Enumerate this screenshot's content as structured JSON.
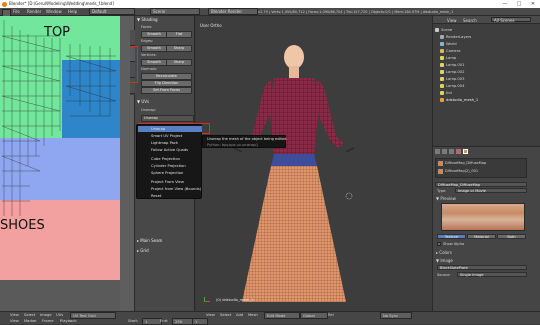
{
  "window": {
    "title": "Blender* [D:\\Gerul\\Modeling\\Wedding\\meds_f.blend]",
    "controls": [
      "—",
      "□",
      "✕"
    ]
  },
  "menubar": {
    "left": [
      "File",
      "Render",
      "Window",
      "Help"
    ],
    "layout": "Default",
    "scene": "Scene",
    "engine": "Blender Render",
    "info": "v2.79 | Verts:1,050/80,712 | Faces:1,090/66,704 | Tris:157,720 | Objects:0/1 | Mem:164.97M | ddstudio_mesh_1"
  },
  "uv_editor": {
    "top_label": "TOP",
    "bottom_label": "SHOES"
  },
  "shelf": {
    "header": "▼ Shading",
    "faces_label": "Faces:",
    "smooth": "Smooth",
    "flat": "Flat",
    "edges_label": "Edges:",
    "edges_smooth": "Smooth",
    "edges_sharp": "Sharp",
    "vertices_label": "Vertices:",
    "vert_smooth": "Smooth",
    "vert_sharp": "Sharp",
    "normals_label": "Normals:",
    "recalculate": "Recalculate",
    "flip_direction": "Flip Direction",
    "set_from_faces": "Set From Faces",
    "uvs_header": "▼ UVs",
    "unwrap_label": "Unwrap:",
    "unwrap_value": "Unwrap",
    "main_seam": "▸ Main Seam",
    "grid": "▸ Grid"
  },
  "popup": {
    "items": [
      "Unwrap",
      "Smart UV Project",
      "Lightmap Pack",
      "Follow Active Quads",
      "Cube Projection",
      "Cylinder Projection",
      "Sphere Projection",
      "Project From View",
      "Project from View (Bounds)",
      "Reset"
    ]
  },
  "tooltip": {
    "line1": "Unwrap the mesh of the object being edited.",
    "line2": "Python: bpy.ops.uv.unwrap()"
  },
  "viewport": {
    "label": "User Ortho",
    "object_label": "(0) ddstudio_mesh_1"
  },
  "outliner": {
    "header_view": "View",
    "header_search": "Search",
    "header_scenes": "All Scenes",
    "rows": [
      {
        "label": "Scene",
        "color": "#c8c8c8"
      },
      {
        "label": "RenderLayers",
        "color": "#a6a6a6"
      },
      {
        "label": "World",
        "color": "#8ab2d8"
      },
      {
        "label": "Camera",
        "color": "#d8b46a"
      },
      {
        "label": "Lamp",
        "color": "#d8d46a"
      },
      {
        "label": "Lamp.001",
        "color": "#d8d46a"
      },
      {
        "label": "Lamp.002",
        "color": "#d8d46a"
      },
      {
        "label": "Lamp.003",
        "color": "#d8d46a"
      },
      {
        "label": "Lamp.004",
        "color": "#d8d46a"
      },
      {
        "label": "Ind",
        "color": "#d8d46a"
      },
      {
        "label": "ddstudio_mesh_1",
        "color": "#e0a04a"
      }
    ]
  },
  "properties": {
    "tex1": "DiffuseMap_DiffuseMap",
    "tex2": "DiffuseMap(2)_001",
    "tex_name": "DiffuseMap_DiffuseMap",
    "type_label": "Type:",
    "type_value": "Image or Movie",
    "preview": "▼ Preview",
    "tab_texture": "Texture",
    "tab_material": "Material",
    "tab_both": "Both",
    "show_alpha": "Show Alpha",
    "colors": "▸ Colors",
    "image": "▼ Image",
    "image_name": "BlackSlatePlate",
    "source_label": "Source:",
    "source_value": "Single Image"
  },
  "bottombar": {
    "uv_row": [
      "View",
      "Select",
      "Image",
      "UVs",
      "UV Test Grid",
      "View",
      "Select",
      "Add",
      "Mesh",
      "Edit Mode",
      "Global",
      "Rel",
      "No Sync"
    ],
    "frame_row": [
      "View",
      "Marker",
      "Frame",
      "Playback",
      "Start:",
      "1",
      "End:",
      "250",
      "1"
    ]
  }
}
